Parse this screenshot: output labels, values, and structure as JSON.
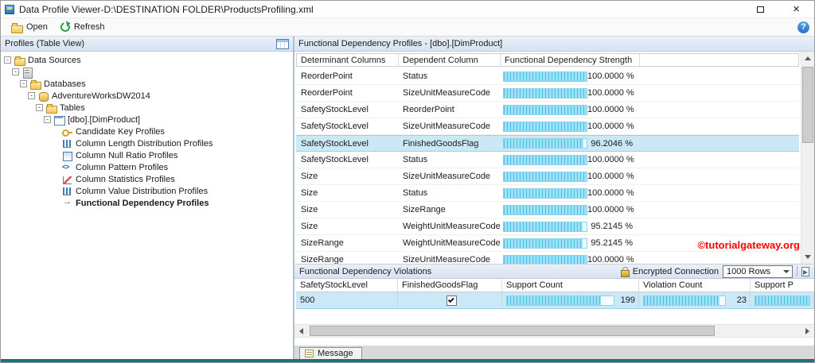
{
  "window": {
    "title": "Data Profile Viewer-D:\\DESTINATION FOLDER\\ProductsProfiling.xml"
  },
  "toolbar": {
    "open_label": "Open",
    "refresh_label": "Refresh"
  },
  "left_panel": {
    "header": "Profiles (Table View)",
    "tree": [
      {
        "label": "Data Sources",
        "level": 0,
        "icon": "folder",
        "expand": true
      },
      {
        "label": "",
        "level": 1,
        "icon": "server",
        "expand": true
      },
      {
        "label": "Databases",
        "level": 2,
        "icon": "folder",
        "expand": true
      },
      {
        "label": "AdventureWorksDW2014",
        "level": 3,
        "icon": "database",
        "expand": true
      },
      {
        "label": "Tables",
        "level": 4,
        "icon": "folder",
        "expand": true
      },
      {
        "label": "[dbo].[DimProduct]",
        "level": 5,
        "icon": "table",
        "expand": true
      },
      {
        "label": "Candidate Key Profiles",
        "level": 6,
        "icon": "key",
        "expand": false
      },
      {
        "label": "Column Length Distribution Profiles",
        "level": 6,
        "icon": "chart",
        "expand": false
      },
      {
        "label": "Column Null Ratio Profiles",
        "level": 6,
        "icon": "null-ratio",
        "expand": false
      },
      {
        "label": "Column Pattern Profiles",
        "level": 6,
        "icon": "pattern",
        "expand": false
      },
      {
        "label": "Column Statistics Profiles",
        "level": 6,
        "icon": "stats",
        "expand": false
      },
      {
        "label": "Column Value Distribution Profiles",
        "level": 6,
        "icon": "value-dist",
        "expand": false
      },
      {
        "label": "Functional Dependency Profiles",
        "level": 6,
        "icon": "fd",
        "expand": false,
        "selected": true
      }
    ]
  },
  "fd_panel": {
    "header": "Functional Dependency Profiles  -  [dbo].[DimProduct]",
    "columns": [
      "Determinant Columns",
      "Dependent Column",
      "Functional Dependency Strength"
    ],
    "rows": [
      {
        "determinant": "ReorderPoint",
        "dependent": "Status",
        "strength_pct": 100,
        "strength_label": "100.0000 %"
      },
      {
        "determinant": "ReorderPoint",
        "dependent": "SizeUnitMeasureCode",
        "strength_pct": 100,
        "strength_label": "100.0000 %"
      },
      {
        "determinant": "SafetyStockLevel",
        "dependent": "ReorderPoint",
        "strength_pct": 100,
        "strength_label": "100.0000 %"
      },
      {
        "determinant": "SafetyStockLevel",
        "dependent": "SizeUnitMeasureCode",
        "strength_pct": 100,
        "strength_label": "100.0000 %"
      },
      {
        "determinant": "SafetyStockLevel",
        "dependent": "FinishedGoodsFlag",
        "strength_pct": 96.2046,
        "strength_label": "96.2046 %",
        "selected": true
      },
      {
        "determinant": "SafetyStockLevel",
        "dependent": "Status",
        "strength_pct": 100,
        "strength_label": "100.0000 %"
      },
      {
        "determinant": "Size",
        "dependent": "SizeUnitMeasureCode",
        "strength_pct": 100,
        "strength_label": "100.0000 %"
      },
      {
        "determinant": "Size",
        "dependent": "Status",
        "strength_pct": 100,
        "strength_label": "100.0000 %"
      },
      {
        "determinant": "Size",
        "dependent": "SizeRange",
        "strength_pct": 100,
        "strength_label": "100.0000 %"
      },
      {
        "determinant": "Size",
        "dependent": "WeightUnitMeasureCode",
        "strength_pct": 95.2145,
        "strength_label": "95.2145 %"
      },
      {
        "determinant": "SizeRange",
        "dependent": "WeightUnitMeasureCode",
        "strength_pct": 95.2145,
        "strength_label": "95.2145 %"
      },
      {
        "determinant": "SizeRange",
        "dependent": "SizeUnitMeasureCode",
        "strength_pct": 100,
        "strength_label": "100.0000 %"
      }
    ],
    "watermark": "©tutorialgateway.org"
  },
  "violations_panel": {
    "header": "Functional Dependency Violations",
    "encrypted_label": "Encrypted Connection",
    "rows_dropdown": "1000 Rows",
    "columns": [
      "SafetyStockLevel",
      "FinishedGoodsFlag",
      "Support Count",
      "Violation Count",
      "Support P"
    ],
    "row": {
      "determinant_value": "500",
      "dependent_checked": true,
      "support_count": "199",
      "support_bar_pct": 88,
      "violation_count": "23",
      "violation_bar_pct": 93,
      "trailing_bar_pct": 100
    }
  },
  "message_bar": {
    "tab_label": "Message"
  },
  "colors": {
    "bar_fill": "#45bfe6",
    "bar_fill_light": "#9fe2f5",
    "selected_row": "#cbe8f6",
    "watermark": "#ff0000",
    "bottom_strip": "#1d6f82"
  }
}
